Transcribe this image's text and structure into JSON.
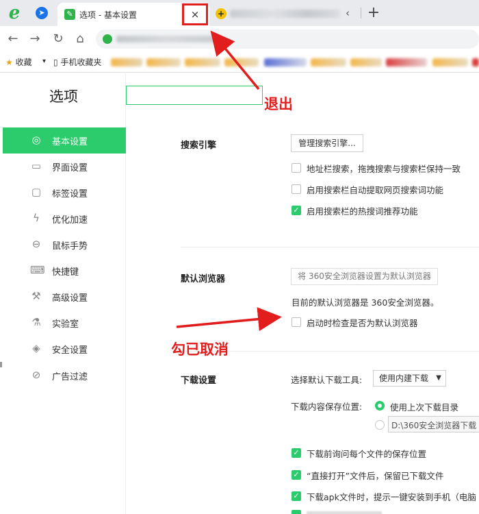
{
  "tabs": {
    "active_title": "选项 - 基本设置",
    "close_glyph": "×",
    "new_tab_glyph": "+",
    "prev_glyph": "‹"
  },
  "toolbar": {
    "back_glyph": "←",
    "forward_glyph": "→",
    "reload_glyph": "↻",
    "home_glyph": "⌂"
  },
  "bookmarks": {
    "favorites_label": "收藏",
    "favorites_dropdown_glyph": "▾",
    "mobile_label": "手机收藏夹"
  },
  "sidebar": {
    "title": "选项",
    "items": [
      {
        "label": "基本设置",
        "icon": "settings-icon",
        "glyph": "◎",
        "active": true
      },
      {
        "label": "界面设置",
        "icon": "window-icon",
        "glyph": "▭",
        "active": false
      },
      {
        "label": "标签设置",
        "icon": "tab-icon",
        "glyph": "▢",
        "active": false
      },
      {
        "label": "优化加速",
        "icon": "lightning-icon",
        "glyph": "ϟ",
        "active": false
      },
      {
        "label": "鼠标手势",
        "icon": "mouse-icon",
        "glyph": "⊖",
        "active": false
      },
      {
        "label": "快捷键",
        "icon": "keyboard-icon",
        "glyph": "⌨",
        "active": false
      },
      {
        "label": "高级设置",
        "icon": "wrench-icon",
        "glyph": "⚒",
        "active": false
      },
      {
        "label": "实验室",
        "icon": "flask-icon",
        "glyph": "⚗",
        "active": false
      },
      {
        "label": "安全设置",
        "icon": "shield-icon",
        "glyph": "◈",
        "active": false
      },
      {
        "label": "广告过滤",
        "icon": "block-icon",
        "glyph": "⊘",
        "active": false
      }
    ]
  },
  "search_engine": {
    "title": "搜索引擎",
    "manage_button": "管理搜索引擎...",
    "options": [
      {
        "label": "地址栏搜索，拖拽搜索与搜索栏保持一致",
        "checked": false
      },
      {
        "label": "启用搜索栏自动提取网页搜索词功能",
        "checked": false
      },
      {
        "label": "启用搜索栏的热搜词推荐功能",
        "checked": true
      }
    ]
  },
  "default_browser": {
    "title": "默认浏览器",
    "set_default_button": "将 360安全浏览器设置为默认浏览器",
    "status_text": "目前的默认浏览器是 360安全浏览器。",
    "check_on_start": {
      "label": "启动时检查是否为默认浏览器",
      "checked": false
    }
  },
  "download": {
    "title": "下载设置",
    "tool_label": "选择默认下载工具:",
    "tool_value": "使用内建下载",
    "location_label": "下载内容保存位置:",
    "location_last": "使用上次下载目录",
    "location_path": "D:\\360安全浏览器下载",
    "options": [
      {
        "label": "下载前询问每个文件的保存位置",
        "checked": true
      },
      {
        "label": "“直接打开”文件后，保留已下载文件",
        "checked": true
      },
      {
        "label": "下载apk文件时，提示一键安装到手机（电脑",
        "checked": true
      }
    ]
  },
  "annotations": {
    "exit_label": "退出",
    "unchecked_label": "勾已取消",
    "color": "#e11d1d"
  },
  "colors": {
    "accent": "#2ccb6c",
    "annotation_red": "#e11d1d"
  }
}
